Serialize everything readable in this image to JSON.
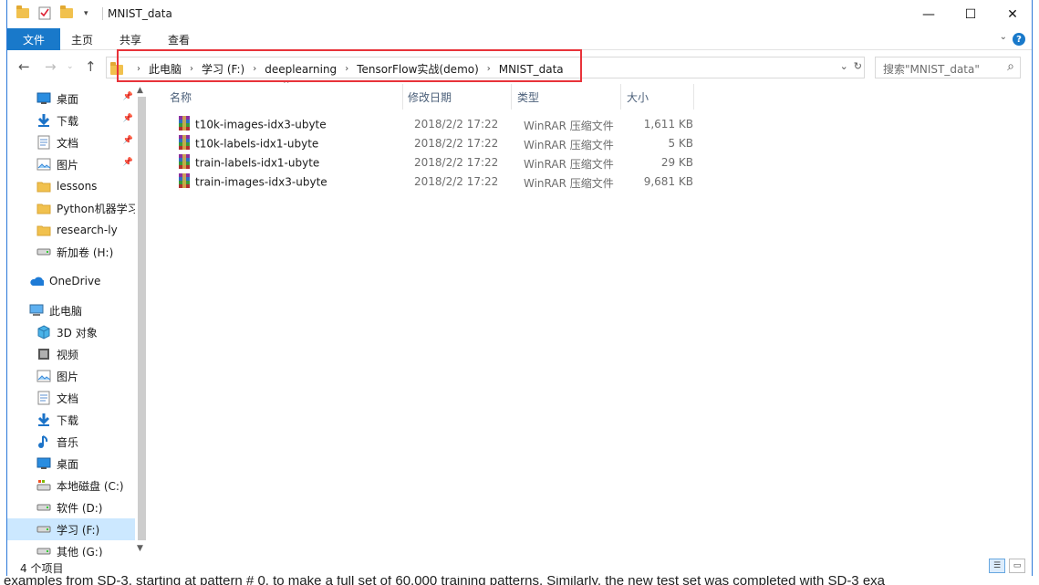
{
  "window": {
    "title": "MNIST_data",
    "minimize": "—",
    "maximize": "☐",
    "close": "✕"
  },
  "ribbon": {
    "file": "文件",
    "tabs": [
      "主页",
      "共享",
      "查看"
    ],
    "help": "?"
  },
  "address": {
    "crumbs": [
      "此电脑",
      "学习 (F:)",
      "deeplearning",
      "TensorFlow实战(demo)",
      "MNIST_data"
    ],
    "separator": "›",
    "search_placeholder": "搜索\"MNIST_data\""
  },
  "nav": {
    "items": [
      {
        "label": "桌面",
        "icon": "desktop-icon",
        "pinned": true
      },
      {
        "label": "下载",
        "icon": "download-icon",
        "pinned": true
      },
      {
        "label": "文档",
        "icon": "document-icon",
        "pinned": true
      },
      {
        "label": "图片",
        "icon": "picture-icon",
        "pinned": true
      },
      {
        "label": "lessons",
        "icon": "folder-icon",
        "pinned": false
      },
      {
        "label": "Python机器学习",
        "icon": "folder-icon",
        "pinned": false
      },
      {
        "label": "research-ly",
        "icon": "folder-icon",
        "pinned": false
      },
      {
        "label": "新加卷 (H:)",
        "icon": "drive-icon",
        "pinned": false
      },
      {
        "label": "OneDrive",
        "icon": "onedrive-icon",
        "pinned": false
      },
      {
        "label": "此电脑",
        "icon": "computer-icon",
        "pinned": false
      },
      {
        "label": "3D 对象",
        "icon": "3d-objects-icon",
        "pinned": false
      },
      {
        "label": "视频",
        "icon": "video-icon",
        "pinned": false
      },
      {
        "label": "图片",
        "icon": "picture-icon",
        "pinned": false
      },
      {
        "label": "文档",
        "icon": "document-icon",
        "pinned": false
      },
      {
        "label": "下载",
        "icon": "download-icon",
        "pinned": false
      },
      {
        "label": "音乐",
        "icon": "music-icon",
        "pinned": false
      },
      {
        "label": "桌面",
        "icon": "desktop-icon",
        "pinned": false
      },
      {
        "label": "本地磁盘 (C:)",
        "icon": "system-drive-icon",
        "pinned": false
      },
      {
        "label": "软件 (D:)",
        "icon": "drive-icon",
        "pinned": false
      },
      {
        "label": "学习 (F:)",
        "icon": "drive-icon",
        "pinned": false,
        "selected": true
      },
      {
        "label": "其他 (G:)",
        "icon": "drive-icon",
        "pinned": false
      }
    ]
  },
  "files": {
    "columns": [
      "名称",
      "修改日期",
      "类型",
      "大小"
    ],
    "rows": [
      {
        "name": "t10k-images-idx3-ubyte",
        "date": "2018/2/2 17:22",
        "type": "WinRAR 压缩文件",
        "size": "1,611 KB"
      },
      {
        "name": "t10k-labels-idx1-ubyte",
        "date": "2018/2/2 17:22",
        "type": "WinRAR 压缩文件",
        "size": "5 KB"
      },
      {
        "name": "train-labels-idx1-ubyte",
        "date": "2018/2/2 17:22",
        "type": "WinRAR 压缩文件",
        "size": "29 KB"
      },
      {
        "name": "train-images-idx3-ubyte",
        "date": "2018/2/2 17:22",
        "type": "WinRAR 压缩文件",
        "size": "9,681 KB"
      }
    ]
  },
  "status": {
    "count": "4 个项目"
  },
  "background": {
    "bottom_text": "examples from SD-3, starting at pattern # 0, to make a full set of 60,000 training patterns. Similarly, the new test set was completed with SD-3 exa"
  },
  "colors": {
    "accent": "#1979ca",
    "selection": "#cce8ff",
    "highlight_box": "#e8333a"
  }
}
